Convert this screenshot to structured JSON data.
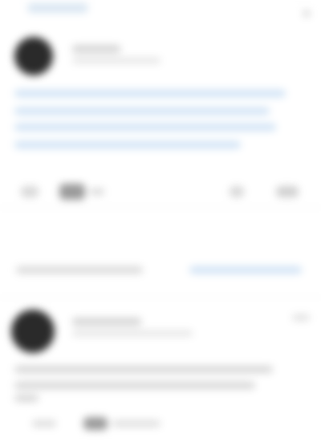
{
  "header": {
    "top_link": "",
    "close_icon": "×"
  },
  "posts": [
    {
      "author": "",
      "meta": "",
      "lines": [
        "",
        "",
        "",
        ""
      ],
      "actions": {
        "reply_count": ""
      }
    },
    {
      "author": "",
      "meta": "",
      "lines": [
        "",
        "",
        ""
      ]
    }
  ],
  "comment_bar": {
    "placeholder": "",
    "action_label": ""
  },
  "colors": {
    "link_blue": "#cfe2f5",
    "avatar": "#2a2a2a",
    "icon_dark": "#9a9a9a"
  },
  "icons": [
    "close-icon",
    "like-icon",
    "reply-icon",
    "share-icon",
    "more-icon"
  ]
}
